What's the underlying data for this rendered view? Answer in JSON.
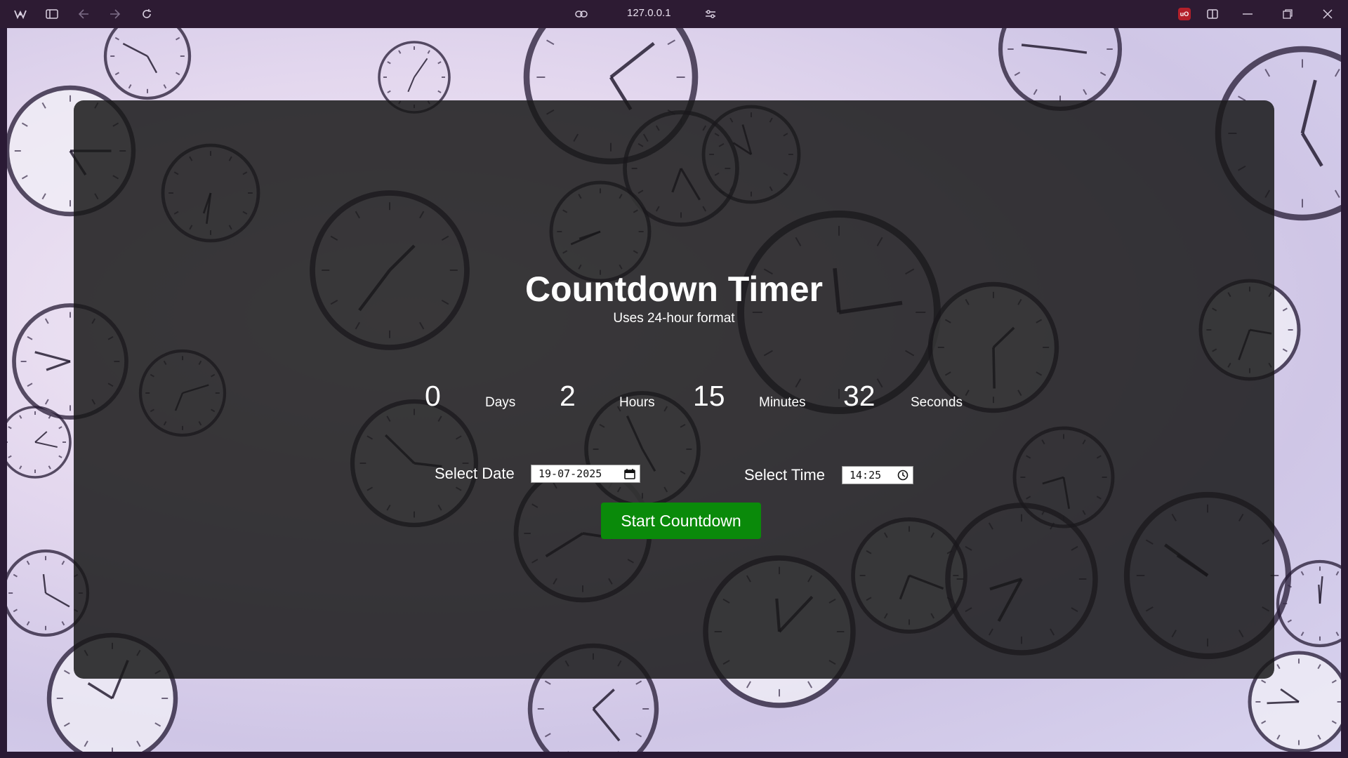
{
  "browser": {
    "url": "127.0.0.1",
    "icons": [
      "browser-logo-icon",
      "sidebar-icon",
      "back-icon",
      "forward-icon",
      "reload-icon",
      "link-icon",
      "site-settings-icon",
      "ublock-icon",
      "split-view-icon",
      "minimize-icon",
      "restore-icon",
      "close-icon"
    ],
    "ublock_label": "uO"
  },
  "page": {
    "title": "Countdown Timer",
    "subtitle": "Uses 24-hour format",
    "countdown": {
      "days_value": "0",
      "days_label": "Days",
      "hours_value": "2",
      "hours_label": "Hours",
      "minutes_value": "15",
      "minutes_label": "Minutes",
      "seconds_value": "32",
      "seconds_label": "Seconds"
    },
    "date_label": "Select Date",
    "date_value": "19-07-2025",
    "time_label": "Select Time",
    "time_value": "14:25",
    "start_button": "Start Countdown",
    "colors": {
      "button": "#0a8a0a",
      "panel": "#181818",
      "chrome": "#2d1b33"
    }
  }
}
